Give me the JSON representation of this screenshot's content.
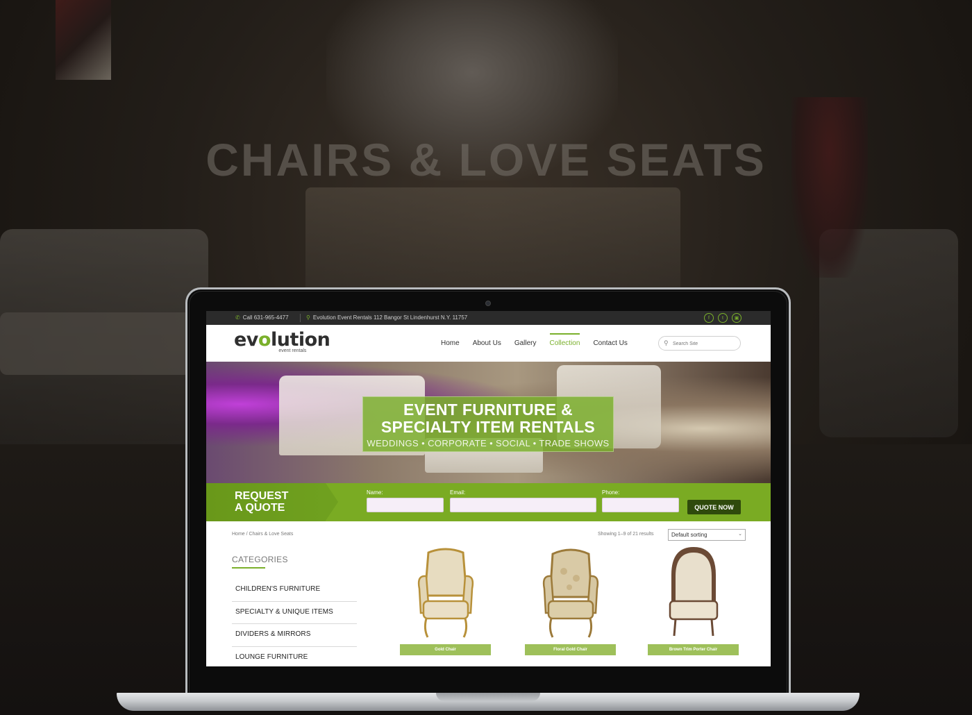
{
  "background": {
    "headline": "CHAIRS & LOVE SEATS"
  },
  "topbar": {
    "phone": "Call 631-965-4477",
    "address": "Evolution Event Rentals 112 Bangor St Lindenhurst N.Y. 11757",
    "social_icons": [
      "facebook-icon",
      "twitter-icon",
      "instagram-icon"
    ]
  },
  "logo": {
    "word_start": "ev",
    "word_o": "o",
    "word_end": "lution",
    "tagline": "event rentals"
  },
  "nav": {
    "items": [
      "Home",
      "About Us",
      "Gallery",
      "Collection",
      "Contact Us"
    ],
    "active": "Collection"
  },
  "search": {
    "placeholder": "Search Site"
  },
  "hero": {
    "title_line1": "EVENT FURNITURE &",
    "title_line2": "SPECIALTY ITEM RENTALS",
    "subtitle": "WEDDINGS • CORPORATE • SOCIAL • TRADE SHOWS"
  },
  "quote": {
    "title_line1": "REQUEST",
    "title_line2": "A QUOTE",
    "name_label": "Name:",
    "email_label": "Email:",
    "phone_label": "Phone:",
    "button": "QUOTE NOW"
  },
  "shop": {
    "breadcrumb": "Home / Chairs & Love Seats",
    "results": "Showing 1–9 of 21 results",
    "sort": "Default sorting"
  },
  "categories": {
    "heading": "CATEGORIES",
    "items": [
      "CHILDREN'S FURNITURE",
      "SPECIALTY & UNIQUE ITEMS",
      "DIVIDERS & MIRRORS",
      "LOUNGE FURNITURE"
    ]
  },
  "products": [
    {
      "name": "Gold Chair"
    },
    {
      "name": "Floral Gold Chair"
    },
    {
      "name": "Brown Trim Porter Chair"
    }
  ],
  "colors": {
    "accent": "#7ab02b",
    "dark_button": "#2f4a0c",
    "topbar": "#2b2b2b"
  }
}
